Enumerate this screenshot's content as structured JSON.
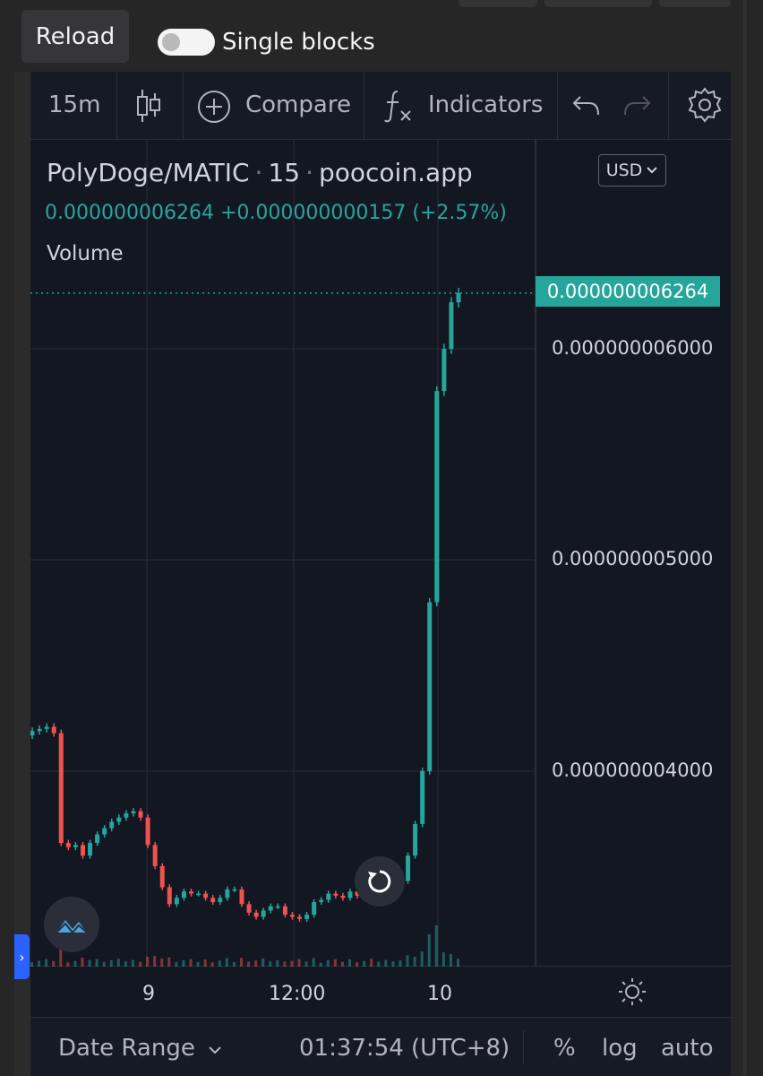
{
  "top": {
    "reload_label": "Reload",
    "single_blocks_label": "Single blocks",
    "single_blocks_on": false
  },
  "toolbar": {
    "interval": "15m",
    "compare_label": "Compare",
    "indicators_label": "Indicators"
  },
  "legend": {
    "symbol": "PolyDoge/MATIC",
    "interval": "15",
    "source": "poocoin.app",
    "last": "0.000000006264",
    "change": "+0.000000000157",
    "change_pct": "(+2.57%)",
    "volume_label": "Volume"
  },
  "currency": "USD",
  "price_axis": {
    "last_price": "0.000000006264",
    "labels": [
      "0.000000006000",
      "0.000000005000",
      "0.000000004000"
    ]
  },
  "time_axis": {
    "labels": [
      "9",
      "12:00",
      "10"
    ]
  },
  "bottom": {
    "date_range_label": "Date Range",
    "clock": "01:37:54 (UTC+8)",
    "percent_label": "%",
    "log_label": "log",
    "auto_label": "auto"
  },
  "colors": {
    "up": "#26a69a",
    "down": "#ef5350",
    "background": "#131722",
    "grid": "#2a2e39"
  },
  "chart_data": {
    "type": "candlestick",
    "pair": "PolyDoge/MATIC",
    "interval": "15m",
    "y_ticks": [
      4e-09,
      5e-09,
      6e-09
    ],
    "last_price": 6.264e-09,
    "x_ticks": [
      "9",
      "12:00",
      "10"
    ],
    "approx_close_series": [
      4.19e-09,
      4.2e-09,
      4.21e-09,
      4.18e-09,
      3.66e-09,
      3.64e-09,
      3.65e-09,
      3.6e-09,
      3.66e-09,
      3.7e-09,
      3.73e-09,
      3.76e-09,
      3.78e-09,
      3.8e-09,
      3.81e-09,
      3.78e-09,
      3.65e-09,
      3.55e-09,
      3.45e-09,
      3.37e-09,
      3.4e-09,
      3.43e-09,
      3.42e-09,
      3.42e-09,
      3.4e-09,
      3.38e-09,
      3.4e-09,
      3.44e-09,
      3.44e-09,
      3.37e-09,
      3.33e-09,
      3.31e-09,
      3.34e-09,
      3.36e-09,
      3.36e-09,
      3.32e-09,
      3.31e-09,
      3.3e-09,
      3.32e-09,
      3.38e-09,
      3.39e-09,
      3.42e-09,
      3.41e-09,
      3.4e-09,
      3.43e-09,
      3.41e-09,
      3.42e-09,
      3.4e-09,
      3.41e-09,
      3.42e-09,
      3.46e-09,
      3.48e-09,
      3.6e-09,
      3.75e-09,
      4e-09,
      4.8e-09,
      5.8e-09,
      6e-09,
      6.22e-09,
      6.264e-09
    ]
  }
}
